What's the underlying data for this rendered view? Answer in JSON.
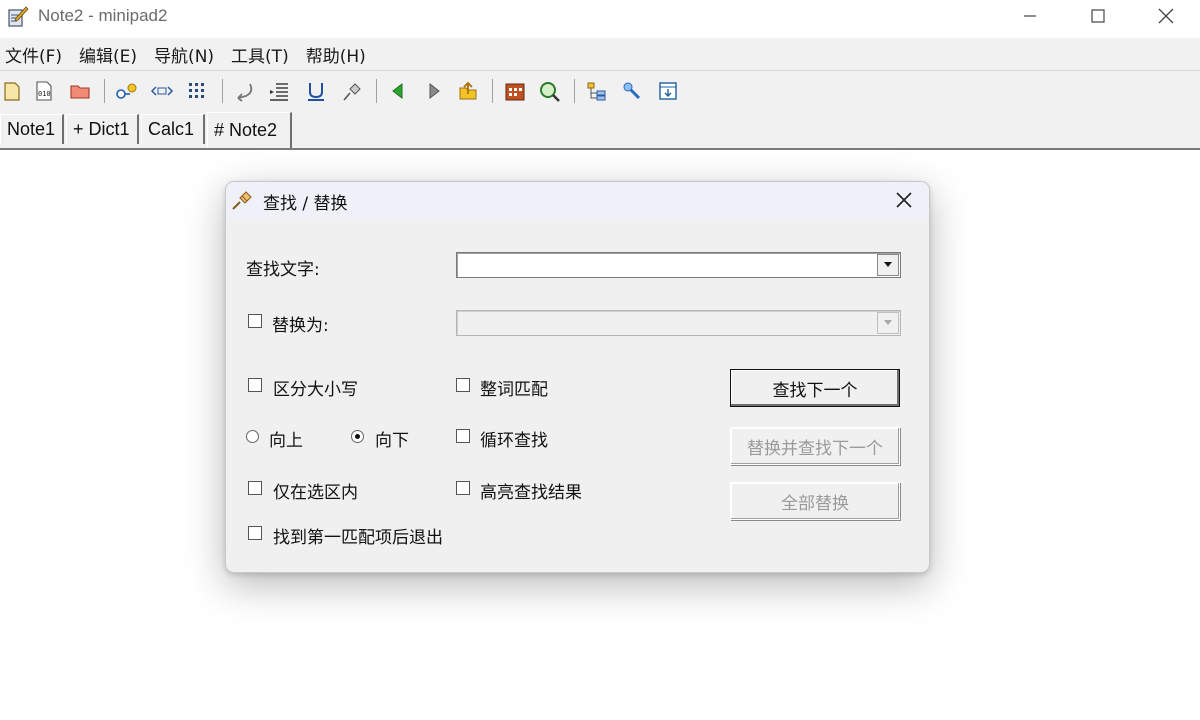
{
  "window": {
    "title": "Note2 - minipad2",
    "icon": "notepad-pen-icon"
  },
  "menu": [
    "文件(F)",
    "编辑(E)",
    "导航(N)",
    "工具(T)",
    "帮助(H)"
  ],
  "toolbar_icons": [
    "new-note-icon",
    "new-binary-icon",
    "open-folder-icon",
    "add-item-icon",
    "insert-tag-icon",
    "grid-list-icon",
    "undo-arrow-icon",
    "text-align-icon",
    "underline-icon",
    "pin-icon",
    "back-icon",
    "forward-icon",
    "up-folder-icon",
    "calendar-icon",
    "search-zoom-icon",
    "outline-icon",
    "settings-tool-icon",
    "save-down-icon"
  ],
  "tabs": [
    "Note1",
    "+ Dict1",
    "Calc1",
    "# Note2"
  ],
  "active_tab": "# Note2",
  "dialog": {
    "title": "查找 / 替换",
    "find_label": "查找文字:",
    "find_value": "",
    "replace_label": "替换为:",
    "replace_value": "",
    "options": {
      "match_case": "区分大小写",
      "whole_word": "整词匹配",
      "direction_up": "向上",
      "direction_down": "向下",
      "wrap_search": "循环查找",
      "in_selection": "仅在选区内",
      "highlight_results": "高亮查找结果",
      "exit_after_first": "找到第一匹配项后退出"
    },
    "direction_selected": "向下",
    "buttons": {
      "find_next": "查找下一个",
      "replace_find_next": "替换并查找下一个",
      "replace_all": "全部替换"
    }
  }
}
